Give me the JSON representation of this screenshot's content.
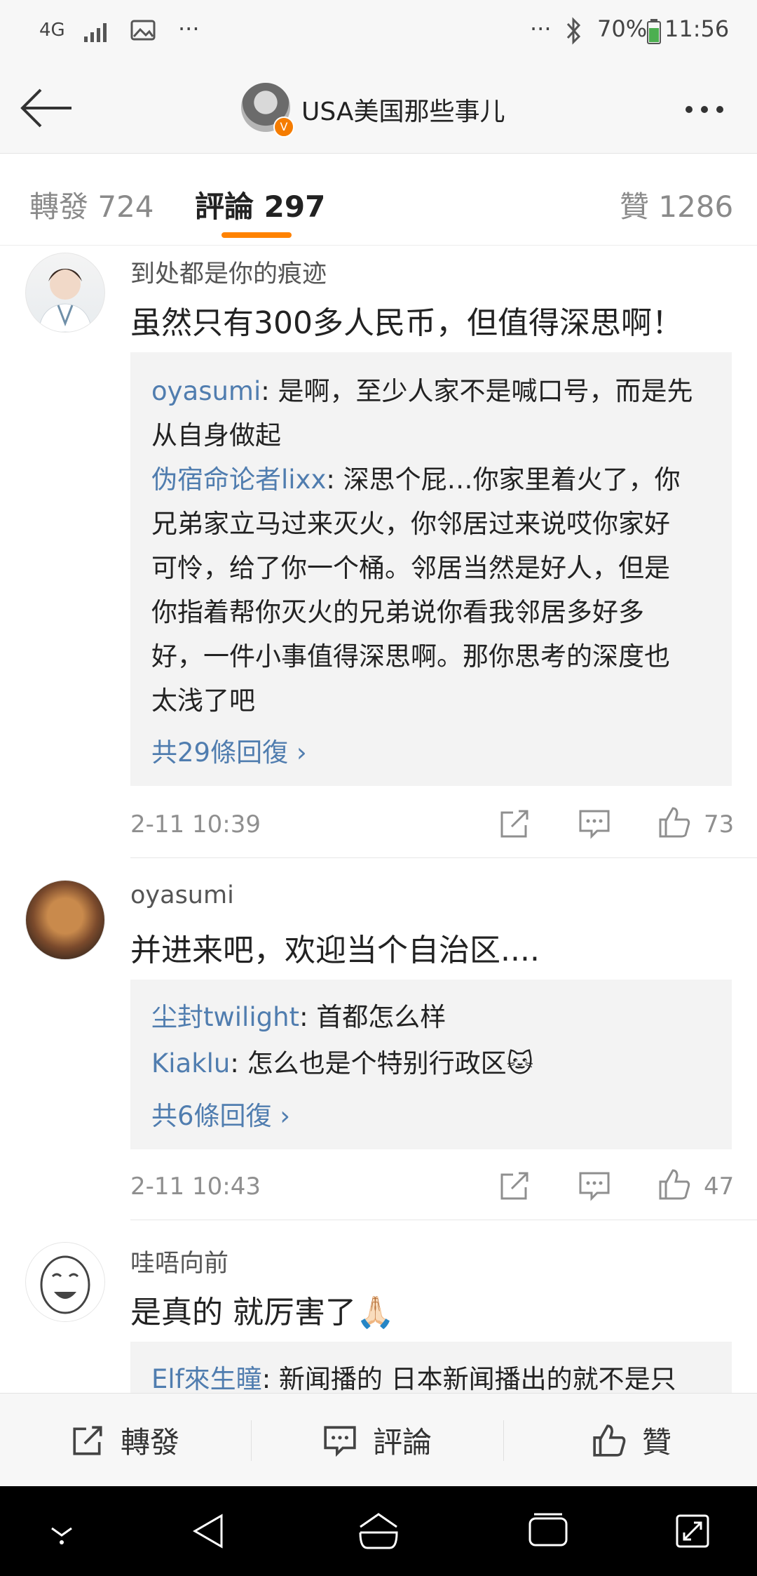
{
  "status_bar": {
    "network": "4G",
    "dots_left": "···",
    "dots_right": "···",
    "battery": "70%",
    "time": "11:56"
  },
  "header": {
    "title": "USA美国那些事儿",
    "verified_badge": "V"
  },
  "tabs": [
    {
      "label": "轉發 724"
    },
    {
      "label": "評論 297"
    },
    {
      "label": "贊 1286"
    }
  ],
  "comments": [
    {
      "username": "到处都是你的痕迹",
      "text": "虽然只有300多人民币，但值得深思啊！",
      "replies": [
        {
          "name": "oyasumi",
          "lines": [
            ": 是啊，至少人家不是喊口号，而是先",
            "从自身做起"
          ]
        },
        {
          "name": "伪宿命论者lixx",
          "lines": [
            ": 深思个屁…你家里着火了，你",
            "兄弟家立马过来灭火，你邻居过来说哎你家好",
            "可怜，给了你一个桶。邻居当然是好人，但是",
            "你指着帮你灭火的兄弟说你看我邻居多好多",
            "好，一件小事值得深思啊。那你思考的深度也",
            "太浅了吧"
          ]
        }
      ],
      "more_replies": "共29條回復 ›",
      "time": "2-11 10:39",
      "likes": "73"
    },
    {
      "username": "oyasumi",
      "text": "并进来吧，欢迎当个自治区....",
      "replies": [
        {
          "name": "尘封twilight",
          "lines": [
            ": 首都怎么样"
          ]
        },
        {
          "name": "Kiaklu",
          "lines": [
            ": 怎么也是个特别行政区🐱"
          ]
        }
      ],
      "more_replies": "共6條回復 ›",
      "time": "2-11 10:43",
      "likes": "47"
    },
    {
      "username": "哇唔向前",
      "text": "是真的 就厉害了🙏🏻",
      "replies": [
        {
          "name": "Elf來生瞳",
          "lines": [
            ": 新闻播的 日本新闻播出的就不是只"
          ]
        }
      ]
    }
  ],
  "bottom_bar": {
    "repost": "轉發",
    "comment": "評論",
    "like": "贊"
  },
  "colors": {
    "accent": "#ff8200",
    "link": "#507daf",
    "reply_bg": "#f3f3f3"
  },
  "icons": [
    "back-arrow-icon",
    "more-icon",
    "share-icon",
    "comment-icon",
    "like-icon",
    "nav-down-icon",
    "nav-back-icon",
    "nav-home-icon",
    "nav-recent-icon",
    "nav-expand-icon"
  ]
}
